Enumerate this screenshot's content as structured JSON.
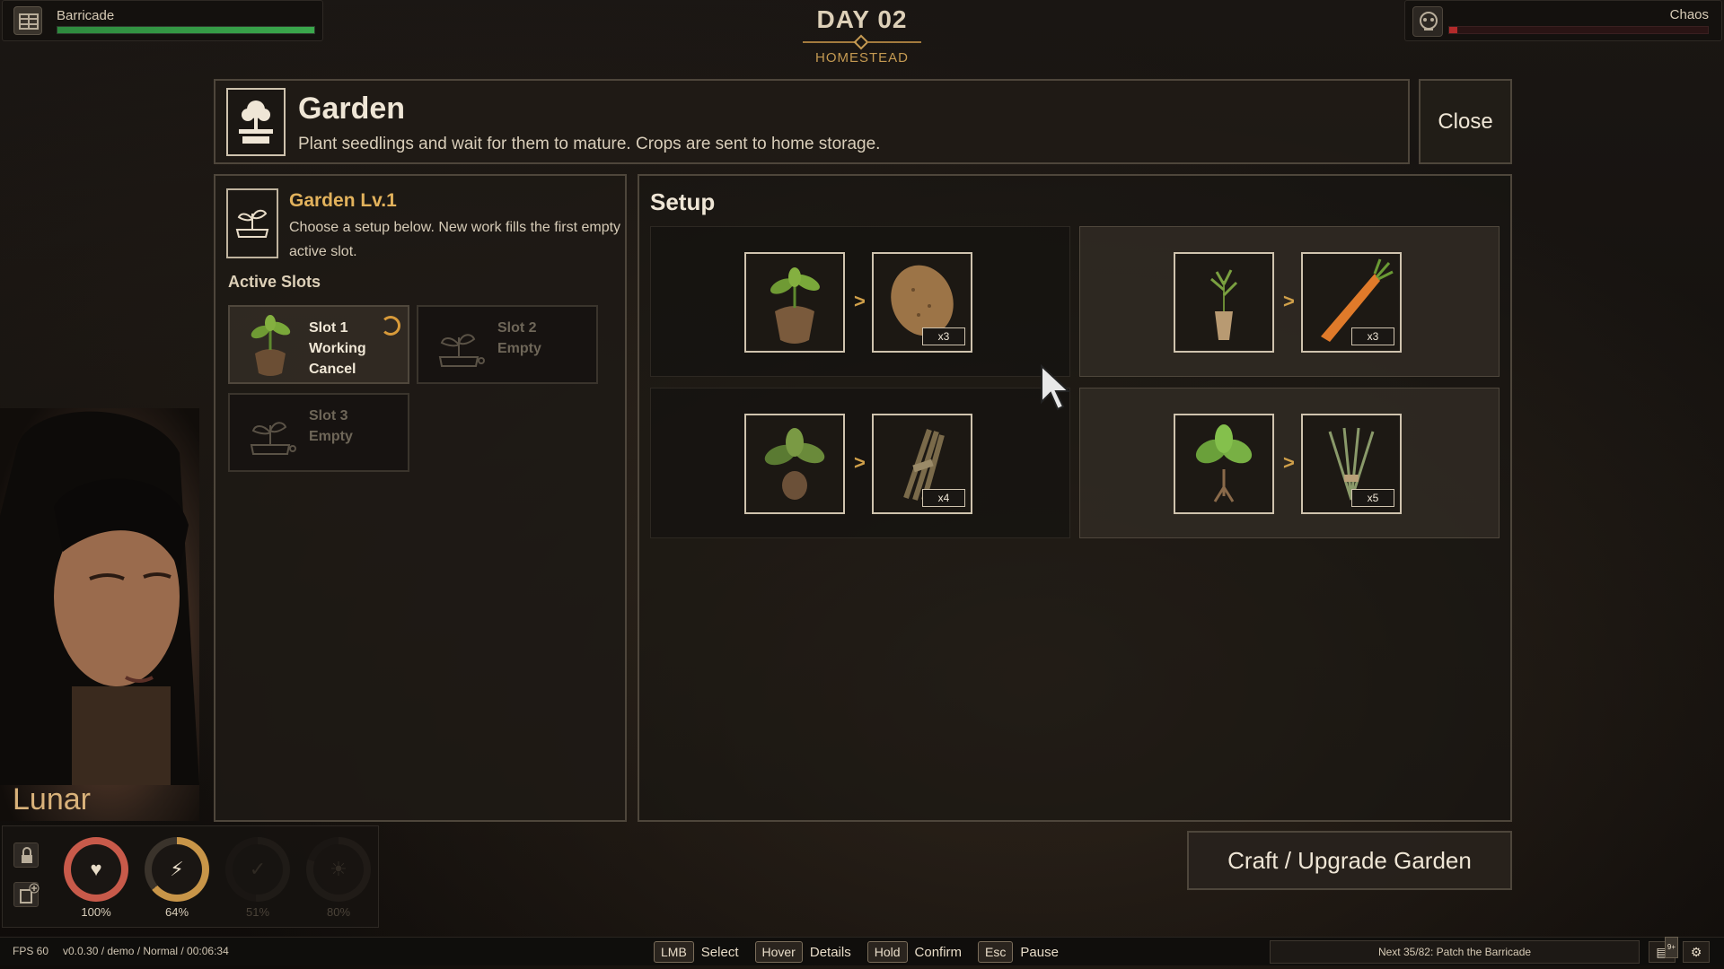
{
  "hud": {
    "barricade_label": "Barricade",
    "barricade_progress": 1.0,
    "chaos_label": "Chaos",
    "chaos_progress": 0.12,
    "day_title": "DAY 02",
    "location": "HOMESTEAD"
  },
  "dialog": {
    "title": "Garden",
    "description": "Plant seedlings and wait for them to mature. Crops are sent to home storage.",
    "close_label": "Close",
    "craft_label": "Craft / Upgrade Garden"
  },
  "building": {
    "level_title": "Garden Lv.1",
    "instructions": "Choose a setup below. New work fills the first empty active slot.",
    "active_slots_title": "Active Slots",
    "slots": [
      {
        "name": "Slot 1",
        "status": "Working",
        "action": "Cancel",
        "icon": "potato-seedling"
      },
      {
        "name": "Slot 2",
        "status": "Empty",
        "icon": "empty-pot"
      },
      {
        "name": "Slot 3",
        "status": "Empty",
        "icon": "empty-pot"
      }
    ]
  },
  "setup": {
    "title": "Setup",
    "arrow": ">",
    "recipes": [
      {
        "input_icon": "potato-seedling",
        "output_icon": "potato",
        "quantity": "x3"
      },
      {
        "input_icon": "carrot-seedling",
        "output_icon": "carrot",
        "quantity": "x3"
      },
      {
        "input_icon": "sapling-leaves",
        "output_icon": "stick-bundle",
        "quantity": "x4"
      },
      {
        "input_icon": "green-sprout",
        "output_icon": "herb-bundle",
        "quantity": "x5"
      }
    ]
  },
  "character": {
    "name": "Lunar",
    "stats": [
      {
        "icon": "heart-icon",
        "value": "100%",
        "color": "#c85a4a"
      },
      {
        "icon": "energy-icon",
        "value": "64%",
        "color": "#c89548"
      },
      {
        "icon": "food-icon",
        "value": "51%",
        "color": "#3a332b"
      },
      {
        "icon": "sun-icon",
        "value": "80%",
        "color": "#3a332b"
      }
    ]
  },
  "bottom": {
    "fps": "FPS 60",
    "version": "v0.0.30 / demo / Normal / 00:06:34",
    "keys": [
      {
        "key": "LMB",
        "action": "Select"
      },
      {
        "key": "Hover",
        "action": "Details"
      },
      {
        "key": "Hold",
        "action": "Confirm"
      },
      {
        "key": "Esc",
        "action": "Pause"
      }
    ],
    "quest": "Next 35/82: Patch the Barricade",
    "badge": "9+"
  }
}
